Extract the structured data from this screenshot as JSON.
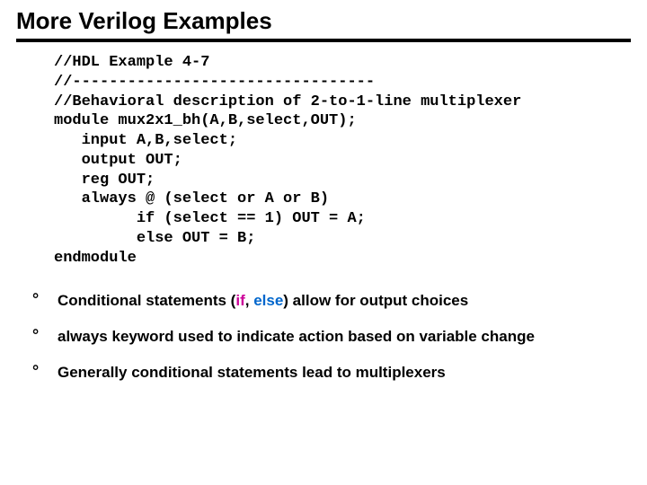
{
  "title": "More Verilog Examples",
  "code": {
    "l1": "//HDL Example 4-7",
    "l2": "//---------------------------------",
    "l3": "//Behavioral description of 2-to-1-line multiplexer",
    "l4": "module mux2x1_bh(A,B,select,OUT);",
    "l5": "   input A,B,select;",
    "l6": "   output OUT;",
    "l7": "   reg OUT;",
    "l8": "   always @ (select or A or B)",
    "l9": "         if (select == 1) OUT = A;",
    "l10": "         else OUT = B;",
    "l11": "endmodule"
  },
  "bullets": {
    "b1_pre": "Conditional statements (",
    "b1_if": "if",
    "b1_sep": ", ",
    "b1_else": "else",
    "b1_post": ") allow for output choices",
    "b2_kw": "always",
    "b2_post": " keyword used to indicate action based on variable change",
    "b3": "Generally conditional statements lead to multiplexers"
  }
}
